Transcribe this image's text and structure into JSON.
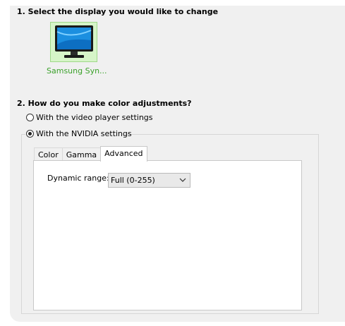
{
  "step1": {
    "title": "1. Select the display you would like to change",
    "display_label": "Samsung Syn...",
    "display_icon": "monitor-icon"
  },
  "step2": {
    "title": "2. How do you make color adjustments?",
    "options": [
      {
        "label": "With the video player settings",
        "selected": false
      },
      {
        "label": "With the NVIDIA settings",
        "selected": true
      }
    ]
  },
  "tabs": [
    {
      "label": "Color",
      "active": false
    },
    {
      "label": "Gamma",
      "active": false
    },
    {
      "label": "Advanced",
      "active": true
    }
  ],
  "advanced": {
    "dynamic_range_label": "Dynamic range:",
    "dynamic_range_value": "Full (0-255)"
  },
  "colors": {
    "panel_bg": "#f0f0f0",
    "selected_tile_bg": "#d6f5c8",
    "display_label_color": "#3aa12a"
  }
}
